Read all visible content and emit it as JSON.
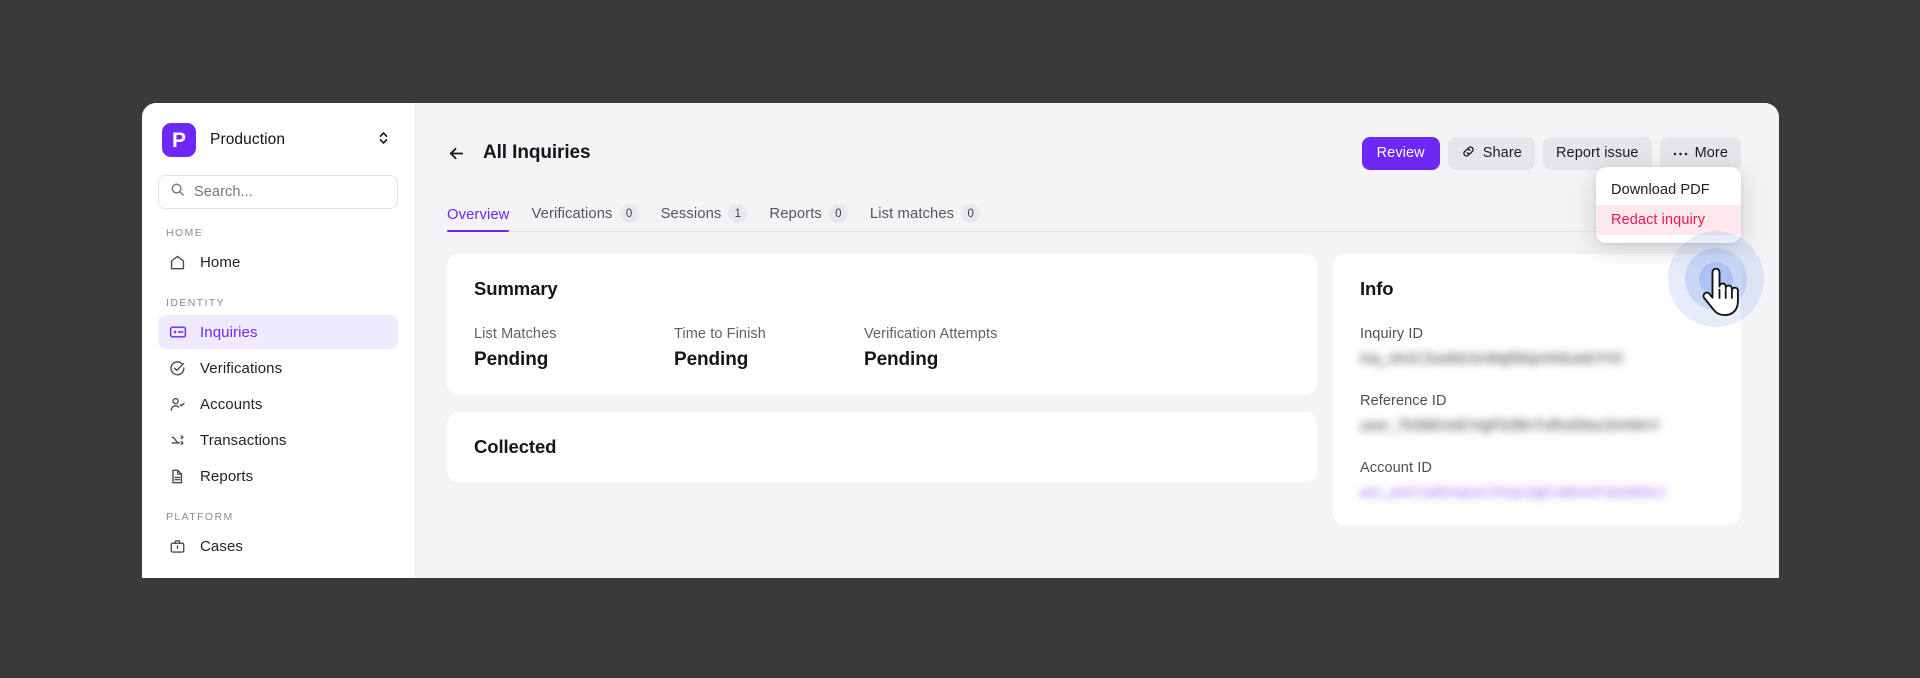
{
  "sidebar": {
    "environment": {
      "label": "Production",
      "logo_letter": "P",
      "logo_color": "#6d28f5"
    },
    "search": {
      "placeholder": "Search..."
    },
    "sections": [
      {
        "label": "HOME",
        "items": [
          {
            "label": "Home",
            "icon": "home-icon",
            "active": false
          }
        ]
      },
      {
        "label": "IDENTITY",
        "items": [
          {
            "label": "Inquiries",
            "icon": "id-card-icon",
            "active": true
          },
          {
            "label": "Verifications",
            "icon": "check-circle-icon",
            "active": false
          },
          {
            "label": "Accounts",
            "icon": "user-check-icon",
            "active": false
          },
          {
            "label": "Transactions",
            "icon": "arrow-transfer-icon",
            "active": false
          },
          {
            "label": "Reports",
            "icon": "document-icon",
            "active": false
          }
        ]
      },
      {
        "label": "PLATFORM",
        "items": [
          {
            "label": "Cases",
            "icon": "briefcase-icon",
            "active": false
          }
        ]
      }
    ]
  },
  "header": {
    "back_icon": "arrow-left-icon",
    "title": "All Inquiries",
    "buttons": [
      {
        "label": "Review",
        "style": "primary",
        "icon": null
      },
      {
        "label": "Share",
        "style": "default",
        "icon": "link-icon"
      },
      {
        "label": "Report issue",
        "style": "default",
        "icon": null
      },
      {
        "label": "More",
        "style": "default",
        "icon": "ellipsis-icon"
      }
    ]
  },
  "more_menu": {
    "items": [
      {
        "label": "Download PDF",
        "danger": false
      },
      {
        "label": "Redact inquiry",
        "danger": true
      }
    ]
  },
  "tabs": [
    {
      "label": "Overview",
      "badge": null,
      "active": true
    },
    {
      "label": "Verifications",
      "badge": "0",
      "active": false
    },
    {
      "label": "Sessions",
      "badge": "1",
      "active": false
    },
    {
      "label": "Reports",
      "badge": "0",
      "active": false
    },
    {
      "label": "List matches",
      "badge": "0",
      "active": false
    }
  ],
  "summary": {
    "title": "Summary",
    "stats": [
      {
        "label": "List Matches",
        "value": "Pending"
      },
      {
        "label": "Time to Finish",
        "value": "Pending"
      },
      {
        "label": "Verification Attempts",
        "value": "Pending"
      }
    ]
  },
  "collected": {
    "title": "Collected"
  },
  "info": {
    "title": "Info",
    "fields": [
      {
        "label": "Inquiry ID",
        "value": "inq_xKeC3ueMzSnWgfWqmN9uwbYH2",
        "redacted": true,
        "link": false
      },
      {
        "label": "Reference ID",
        "value": "user_7b3bEmdCHgFb2BnTufhsDbwJ2mWnY",
        "redacted": true,
        "link": false
      },
      {
        "label": "Account ID",
        "value": "act_umC1wbVqsuC3VqcSgFuWmvFvbmkDnJ",
        "redacted": true,
        "link": true
      }
    ]
  },
  "colors": {
    "accent": "#6d28f5",
    "danger": "#e8174c",
    "danger_bg": "#fde8ee",
    "active_bg": "#f0eaff",
    "app_bg": "#f4f4f6",
    "desktop_bg": "#3a3a3a"
  }
}
